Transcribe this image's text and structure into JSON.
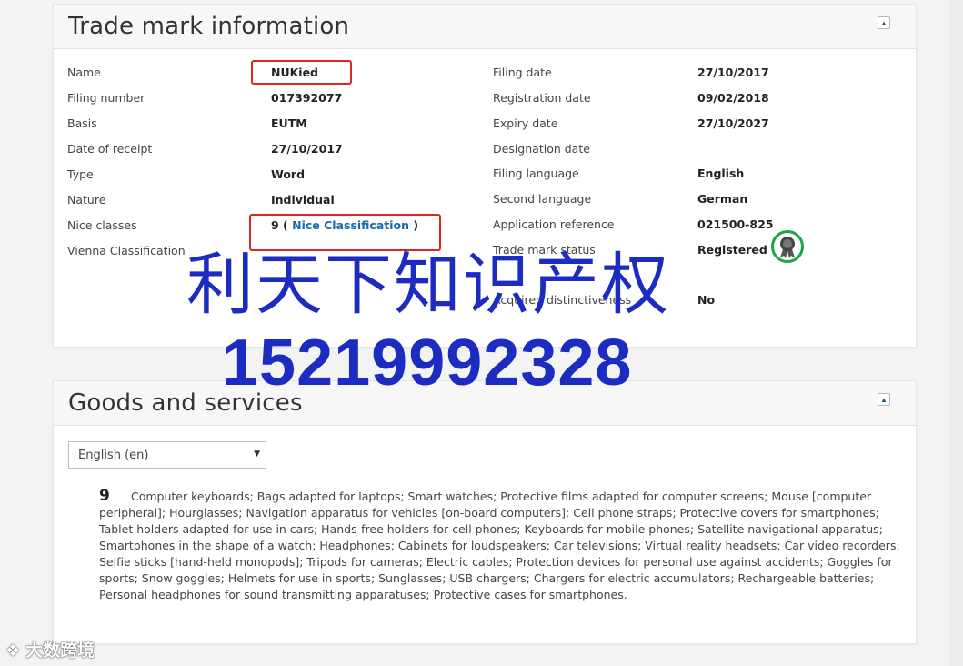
{
  "trademark_info": {
    "title": "Trade mark information",
    "collapse_icon": "caret-up-icon",
    "left_fields": [
      {
        "label": "Name",
        "value": "NUKied"
      },
      {
        "label": "Filing number",
        "value": "017392077"
      },
      {
        "label": "Basis",
        "value": "EUTM"
      },
      {
        "label": "Date of receipt",
        "value": "27/10/2017"
      },
      {
        "label": "Type",
        "value": "Word"
      },
      {
        "label": "Nature",
        "value": "Individual"
      },
      {
        "label": "Nice classes",
        "value_number": "9 (",
        "value_link": "Nice Classification",
        "value_close": ")"
      },
      {
        "label": "Vienna Classification",
        "value": ""
      }
    ],
    "right_fields": [
      {
        "label": "Filing date",
        "value": "27/10/2017"
      },
      {
        "label": "Registration date",
        "value": "09/02/2018"
      },
      {
        "label": "Expiry date",
        "value": "27/10/2027"
      },
      {
        "label": "Designation date",
        "value": ""
      },
      {
        "label": "Filing language",
        "value": "English"
      },
      {
        "label": "Second language",
        "value": "German"
      },
      {
        "label": "Application reference",
        "value": "021500-825"
      },
      {
        "label": "Trade mark status",
        "value": "Registered"
      },
      {
        "label": "Acquired distinctiveness",
        "value": "No"
      }
    ],
    "status_icon": "registered-seal-icon"
  },
  "goods_services": {
    "title": "Goods and services",
    "collapse_icon": "caret-up-icon",
    "language_select": "English (en)",
    "class_number": "9",
    "class_text": "Computer keyboards; Bags adapted for laptops; Smart watches; Protective films adapted for computer screens; Mouse [computer peripheral]; Hourglasses; Navigation apparatus for vehicles [on-board computers]; Cell phone straps; Protective covers for smartphones; Tablet holders adapted for use in cars; Hands-free holders for cell phones; Keyboards for mobile phones; Satellite navigational apparatus; Smartphones in the shape of a watch; Headphones; Cabinets for loudspeakers; Car televisions; Virtual reality headsets; Car video recorders; Selfie sticks [hand-held monopods]; Tripods for cameras; Electric cables; Protection devices for personal use against accidents; Goggles for sports; Snow goggles; Helmets for use in sports; Sunglasses; USB chargers; Chargers for electric accumulators; Rechargeable batteries; Personal headphones for sound transmitting apparatuses; Protective cases for smartphones."
  },
  "watermark": {
    "text_cn": "利天下知识产权",
    "phone": "15219992328",
    "corner_logo": "大数跨境",
    "corner_icon": "k-logo-icon"
  },
  "colors": {
    "link": "#1a6aa8",
    "highlight_box": "#e02424",
    "status_ring": "#1fa347",
    "watermark": "#1c2bc0"
  }
}
